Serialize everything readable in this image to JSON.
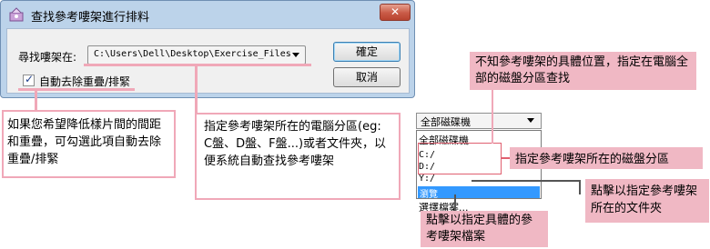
{
  "dialog": {
    "title": "查找參考嘍架進行排料",
    "close_label": "✕",
    "search_label": "尋找嘍架在:",
    "search_value": "C:\\Users\\Dell\\Desktop\\Exercise_Files",
    "auto_remove_label": "自動去除重疊/排緊",
    "auto_remove_checked": true,
    "check_mark": "✓",
    "ok_label": "確定",
    "cancel_label": "取消"
  },
  "dropdown": {
    "selected": "全部磁碟機",
    "items": [
      "全部磁碟機",
      "C:/",
      "D:/",
      "Y:/",
      "瀏覽",
      "選擇檔案..."
    ]
  },
  "annotations": {
    "checkbox_note": "如果您希望降低樣片間的間距和重疊，可勾選此項自動去除重疊/排緊",
    "location_note": "指定參考嘍架所在的電腦分區(eg: C盤、D盤、F盤...)或者文件夾，以便系統自動查找參考嘍架",
    "unknown_location_note": "不知參考嘍架的具體位置，指定在電腦全部的磁盤分區查找",
    "drive_note": "指定參考嘍架所在的磁盤分區",
    "browse_note": "點擊以指定參考嘍架所在的文件夾",
    "select_file_note": "點擊以指定具體的參考嘍架檔案"
  },
  "colors": {
    "annotation_pink": "#f0b8c4",
    "highlight_blue": "#3399ff",
    "dialog_frame": "#bcd3ea"
  }
}
